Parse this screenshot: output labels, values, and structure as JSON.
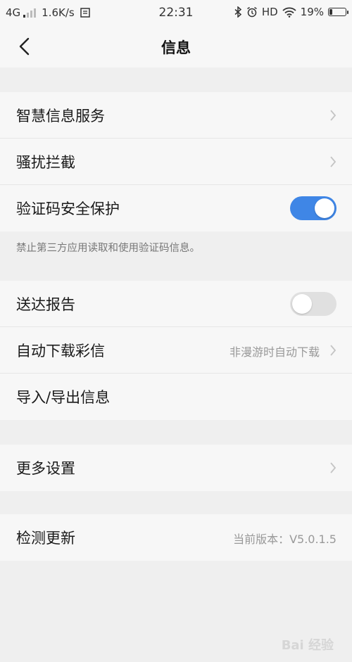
{
  "status_bar": {
    "network": "4G",
    "speed": "1.6K/s",
    "time": "22:31",
    "hd": "HD",
    "battery": "19%",
    "battery_level": 0.19
  },
  "header": {
    "title": "信息"
  },
  "groups": [
    {
      "rows": [
        {
          "label": "智慧信息服务",
          "type": "chevron"
        },
        {
          "label": "骚扰拦截",
          "type": "chevron"
        },
        {
          "label": "验证码安全保护",
          "type": "toggle",
          "on": true
        }
      ],
      "note": "禁止第三方应用读取和使用验证码信息。"
    },
    {
      "rows": [
        {
          "label": "送达报告",
          "type": "toggle",
          "on": false
        },
        {
          "label": "自动下载彩信",
          "type": "value-chevron",
          "value": "非漫游时自动下载"
        },
        {
          "label": "导入/导出信息",
          "type": "plain"
        }
      ]
    },
    {
      "rows": [
        {
          "label": "更多设置",
          "type": "chevron"
        }
      ]
    },
    {
      "rows": [
        {
          "label": "检测更新",
          "type": "value",
          "value": "当前版本：V5.0.1.5"
        }
      ]
    }
  ],
  "watermark": "Bai 经验"
}
